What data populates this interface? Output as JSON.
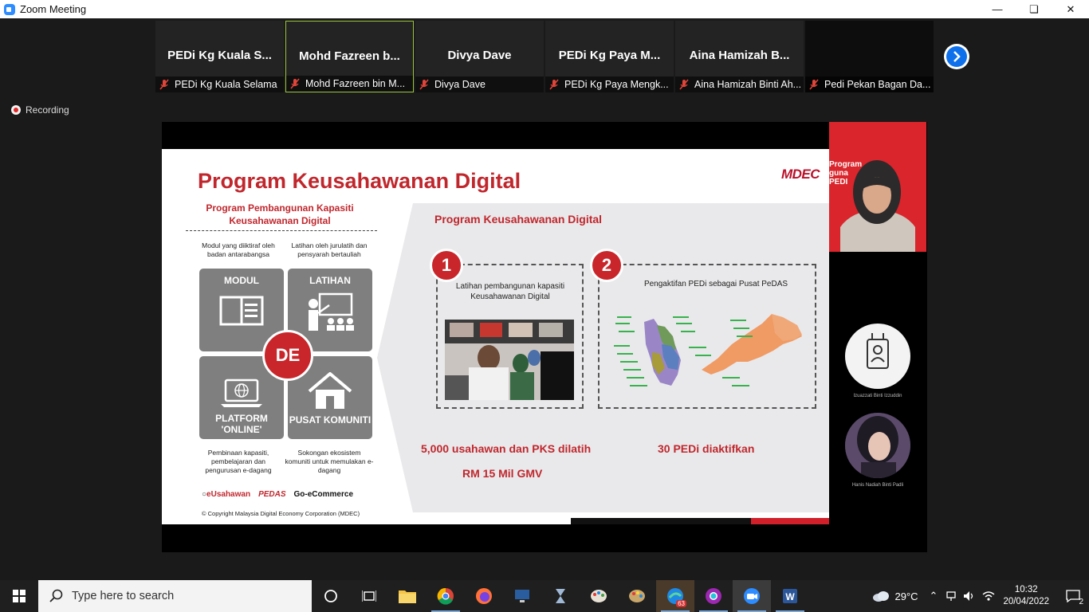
{
  "window": {
    "title": "Zoom Meeting"
  },
  "participants": [
    {
      "display": "PEDi Kg Kuala S...",
      "label": "PEDi Kg Kuala Selama",
      "active": false
    },
    {
      "display": "Mohd Fazreen b...",
      "label": "Mohd Fazreen bin M...",
      "active": true
    },
    {
      "display": "Divya Dave",
      "label": "Divya Dave",
      "active": false
    },
    {
      "display": "PEDi Kg Paya M...",
      "label": "PEDi Kg Paya Mengk...",
      "active": false
    },
    {
      "display": "Aina Hamizah B...",
      "label": "Aina Hamizah Binti Ah...",
      "active": false
    },
    {
      "display": "",
      "label": "Pedi Pekan Bagan Da...",
      "active": false
    }
  ],
  "recording": {
    "label": "Recording"
  },
  "slide": {
    "title": "Program Keusahawanan Digital",
    "logo": "MDEC",
    "left_subtitle": "Program Pembangunan Kapasiti Keusahawanan Digital",
    "caption_modul": "Modul yang diiktiraf oleh badan antarabangsa",
    "caption_latihan": "Latihan oleh jurulatih dan pensyarah bertauliah",
    "box_modul": "MODUL",
    "box_latihan": "LATIHAN",
    "box_platform": "PLATFORM 'ONLINE'",
    "box_pusat": "PUSAT KOMUNITI",
    "center": "DE",
    "caption_platform": "Pembinaan kapasiti, pembelajaran dan pengurusan e-dagang",
    "caption_pusat": "Sokongan ekosistem komuniti untuk memulakan e-dagang",
    "logo_eusahawan": "eUsahawan",
    "logo_pedas": "PEDAS",
    "logo_goecommerce": "Go-eCommerce",
    "copyright": "© Copyright Malaysia Digital Economy Corporation (MDEC)",
    "right_title": "Program Keusahawanan Digital",
    "step1_num": "1",
    "step1_text": "Latihan pembangunan kapasiti Keusahawanan Digital",
    "step2_num": "2",
    "step2_text": "Pengaktifan PEDi sebagai Pusat PeDAS",
    "stat1a": "5,000 usahawan dan PKS dilatih",
    "stat1b": "RM 15 Mil GMV",
    "stat2": "30 PEDi diaktifkan"
  },
  "speaker": {
    "overlay_text": "Program\nguna\nPEDI"
  },
  "side_tiles": [
    {
      "name": "Izuazzati Binti Izzuddin"
    },
    {
      "name": "Hanis Nadiah Binti Padli"
    }
  ],
  "taskbar": {
    "search_placeholder": "Type here to search",
    "weather": "29°C",
    "time": "10:32",
    "date": "20/04/2022",
    "notifications": "2",
    "edge_badge": "63"
  }
}
